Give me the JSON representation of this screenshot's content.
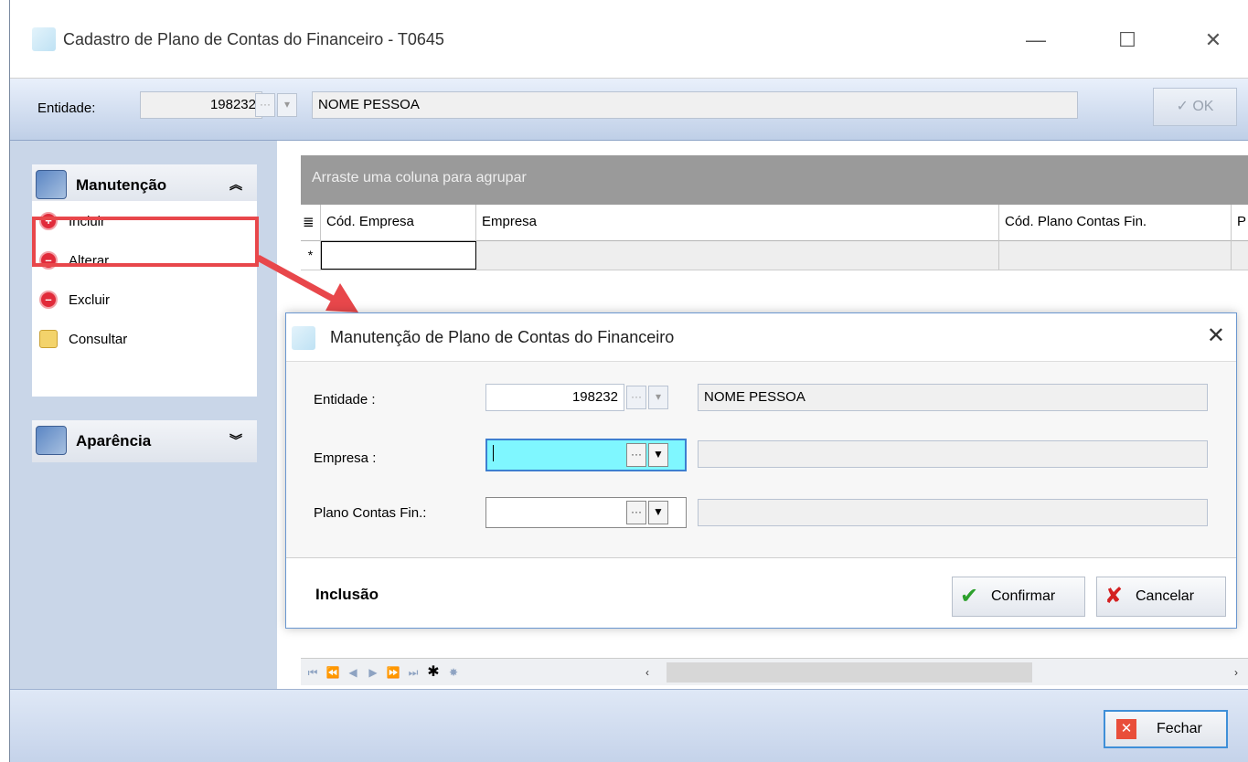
{
  "window": {
    "title": "Cadastro de Plano de Contas do Financeiro - T0645",
    "minimize": "—",
    "maximize": "☐",
    "close": "✕"
  },
  "entity_bar": {
    "label": "Entidade:",
    "code": "198232",
    "name": "NOME PESSOA",
    "ok_label": "OK"
  },
  "sidebar": {
    "manutencao": {
      "title": "Manutenção",
      "items": [
        {
          "label": "Incluir"
        },
        {
          "label": "Alterar"
        },
        {
          "label": "Excluir"
        },
        {
          "label": "Consultar"
        }
      ]
    },
    "aparencia": {
      "title": "Aparência"
    }
  },
  "grid": {
    "group_hint": "Arraste uma coluna para agrupar",
    "columns": [
      "Cód. Empresa",
      "Empresa",
      "Cód. Plano Contas Fin.",
      "P"
    ],
    "new_row_marker": "*"
  },
  "dialog": {
    "title": "Manutenção de Plano de Contas do Financeiro",
    "fields": {
      "entidade": {
        "label": "Entidade :",
        "code": "198232",
        "name": "NOME PESSOA"
      },
      "empresa": {
        "label": "Empresa :",
        "code": "",
        "name": ""
      },
      "plano": {
        "label": "Plano Contas Fin.:",
        "code": "",
        "name": ""
      }
    },
    "mode": "Inclusão",
    "confirm_label": "Confirmar",
    "cancel_label": "Cancelar"
  },
  "footer": {
    "close_label": "Fechar"
  },
  "colors": {
    "highlight": "#e8474b",
    "active_input": "#7ff7ff",
    "accent": "#3f8fd8"
  }
}
